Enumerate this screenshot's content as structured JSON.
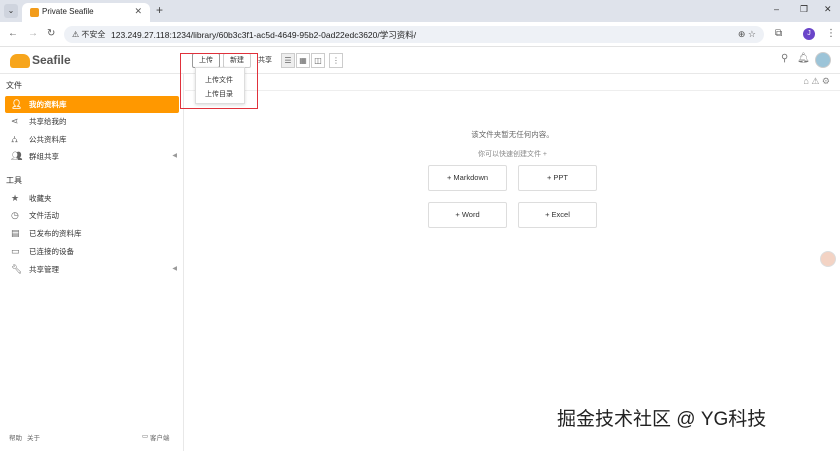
{
  "browser": {
    "tab_title": "Private Seafile",
    "tab_menu_icon": "chevron-down-icon",
    "new_tab_label": "+",
    "insecure_label": "⚠ 不安全",
    "url": "123.249.27.118:1234/library/60b3c3f1-ac5d-4649-95b2-0ad22edc3620/学习资料/",
    "profile_initial": "J",
    "window_controls": [
      "–",
      "❐",
      "✕"
    ]
  },
  "app": {
    "logo_text": "Seafile",
    "toolbar": {
      "upload_label": "上传",
      "new_label": "新建",
      "share_label": "共享"
    },
    "upload_menu": [
      "上传文件",
      "上传目录"
    ]
  },
  "sidebar": {
    "files_title": "文件",
    "files_items": [
      {
        "label": "我的资料库",
        "icon": "user-icon",
        "active": true
      },
      {
        "label": "共享给我的",
        "icon": "share-icon",
        "active": false
      },
      {
        "label": "公共资料库",
        "icon": "org-icon",
        "active": false
      },
      {
        "label": "群组共享",
        "icon": "group-icon",
        "active": false,
        "expandable": true
      }
    ],
    "tools_title": "工具",
    "tools_items": [
      {
        "label": "收藏夹",
        "icon": "star-icon"
      },
      {
        "label": "文件活动",
        "icon": "clock-icon"
      },
      {
        "label": "已发布的资料库",
        "icon": "book-icon"
      },
      {
        "label": "已连接的设备",
        "icon": "monitor-icon"
      },
      {
        "label": "共享管理",
        "icon": "wrench-icon",
        "expandable": true
      }
    ],
    "footer": {
      "help": "帮助",
      "about": "关于",
      "client": "客户端"
    }
  },
  "main": {
    "empty_message": "该文件夹暂无任何内容。",
    "quick_create": "你可以快速创建文件 +",
    "create_buttons": [
      "+ Markdown",
      "+ PPT",
      "+ Word",
      "+ Excel"
    ]
  },
  "watermark": "掘金技术社区 @ YG科技",
  "colors": {
    "accent": "#ff9800",
    "highlight_box": "#e0313b"
  }
}
